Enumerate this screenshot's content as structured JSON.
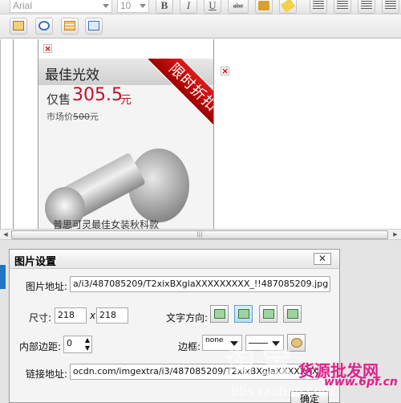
{
  "toolbar": {
    "font_family": "Arial",
    "font_size": "10",
    "bold_label": "B",
    "italic_label": "I",
    "underline_label": "U",
    "strike_label": "abc"
  },
  "ad": {
    "title": "最佳光效",
    "price_prefix": "仅售",
    "price": "305.5",
    "price_unit": "元",
    "market_label": "市场价",
    "market_price": "500",
    "market_unit": "元",
    "ribbon": "限时折扣",
    "caption": "普思可灵最佳女装秋科款"
  },
  "scroll": {
    "thumb_glyph": "|||"
  },
  "dialog": {
    "title": "图片设置",
    "close_glyph": "✕",
    "url_label": "图片地址:",
    "url_value": "a/i3/487085209/T2xixBXglaXXXXXXXXX_!!487085209.jpg",
    "size_label": "尺寸:",
    "width_value": "218",
    "times": "x",
    "height_value": "218",
    "text_dir_label": "文字方向:",
    "padding_label": "内部边距:",
    "padding_value": "0",
    "border_label": "边框:",
    "border_style": "none",
    "link_label": "链接地址:",
    "link_value": "ocdn.com/imgextra/i3/487085209/T2xixBXglaXXXXXXXXX",
    "ok_label": "确定"
  },
  "watermark": {
    "site": "淘宝",
    "domain": "bbs.taobao.com",
    "brand": "货源批发网",
    "brand_url": "www.6pf.cn"
  }
}
